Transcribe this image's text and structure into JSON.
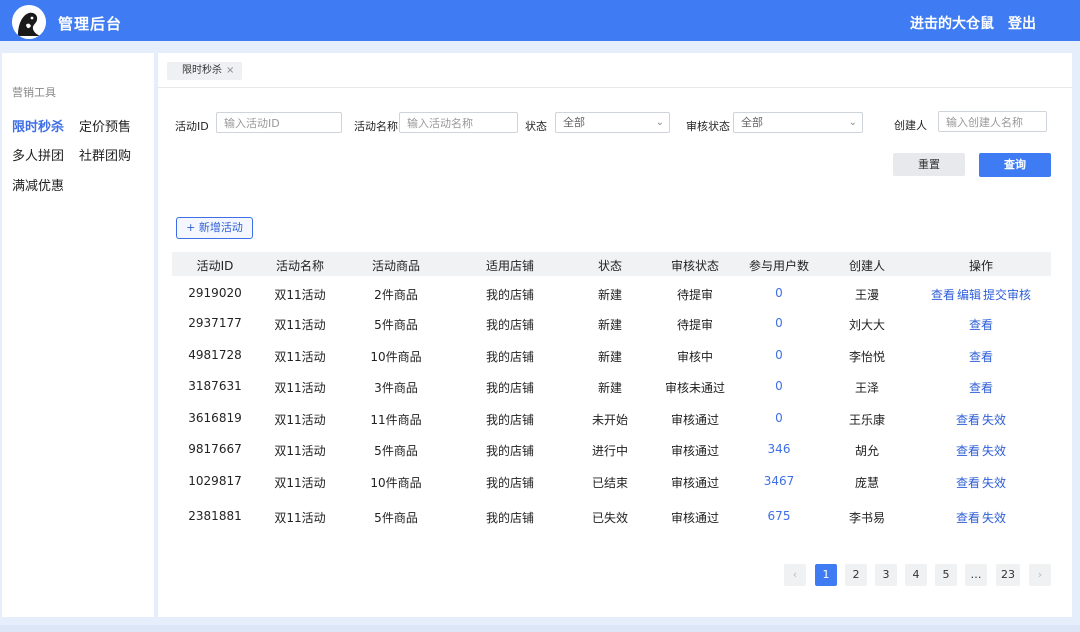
{
  "header": {
    "title": "管理后台",
    "username": "进击的大仓鼠",
    "logout": "登出"
  },
  "sidebar": {
    "section": "营销工具",
    "items": [
      {
        "label": "限时秒杀",
        "active": true
      },
      {
        "label": "定价预售"
      },
      {
        "label": "多人拼团"
      },
      {
        "label": "社群团购"
      },
      {
        "label": "满减优惠"
      }
    ]
  },
  "tabs": [
    {
      "label": "限时秒杀",
      "close": "×"
    }
  ],
  "filters": {
    "activity_id": {
      "label": "活动ID",
      "placeholder": "输入活动ID"
    },
    "activity_name": {
      "label": "活动名称",
      "placeholder": "输入活动名称"
    },
    "status": {
      "label": "状态",
      "value": "全部"
    },
    "review_status": {
      "label": "审核状态",
      "value": "全部"
    },
    "creator": {
      "label": "创建人",
      "placeholder": "输入创建人名称"
    },
    "reset": "重置",
    "query": "查询"
  },
  "add_button": "+ 新增活动",
  "table": {
    "columns": [
      "活动ID",
      "活动名称",
      "活动商品",
      "适用店铺",
      "状态",
      "审核状态",
      "参与用户数",
      "创建人",
      "操作"
    ],
    "rows": [
      {
        "id": "2919020",
        "name": "双11活动",
        "goods": "2件商品",
        "shop": "我的店铺",
        "status": "新建",
        "review": "待提审",
        "users": "0",
        "creator": "王漫",
        "ops": [
          "查看",
          "编辑",
          "提交审核"
        ]
      },
      {
        "id": "2937177",
        "name": "双11活动",
        "goods": "5件商品",
        "shop": "我的店铺",
        "status": "新建",
        "review": "待提审",
        "users": "0",
        "creator": "刘大大",
        "ops": [
          "查看"
        ]
      },
      {
        "id": "4981728",
        "name": "双11活动",
        "goods": "10件商品",
        "shop": "我的店铺",
        "status": "新建",
        "review": "审核中",
        "users": "0",
        "creator": "李怡悦",
        "ops": [
          "查看"
        ]
      },
      {
        "id": "3187631",
        "name": "双11活动",
        "goods": "3件商品",
        "shop": "我的店铺",
        "status": "新建",
        "review": "审核未通过",
        "users": "0",
        "creator": "王泽",
        "ops": [
          "查看"
        ]
      },
      {
        "id": "3616819",
        "name": "双11活动",
        "goods": "11件商品",
        "shop": "我的店铺",
        "status": "未开始",
        "review": "审核通过",
        "users": "0",
        "creator": "王乐康",
        "ops": [
          "查看",
          "失效"
        ]
      },
      {
        "id": "9817667",
        "name": "双11活动",
        "goods": "5件商品",
        "shop": "我的店铺",
        "status": "进行中",
        "review": "审核通过",
        "users": "346",
        "creator": "胡允",
        "ops": [
          "查看",
          "失效"
        ]
      },
      {
        "id": "1029817",
        "name": "双11活动",
        "goods": "10件商品",
        "shop": "我的店铺",
        "status": "已结束",
        "review": "审核通过",
        "users": "3467",
        "creator": "庞慧",
        "ops": [
          "查看",
          "失效"
        ]
      },
      {
        "id": "2381881",
        "name": "双11活动",
        "goods": "5件商品",
        "shop": "我的店铺",
        "status": "已失效",
        "review": "审核通过",
        "users": "675",
        "creator": "李书易",
        "ops": [
          "查看",
          "失效"
        ]
      }
    ]
  },
  "pagination": {
    "prev": "‹",
    "pages": [
      "1",
      "2",
      "3",
      "4",
      "5",
      "…",
      "23"
    ],
    "current": "1",
    "next": "›"
  },
  "colors": {
    "primary": "#3f7cf3",
    "link": "#2f5fd6",
    "background": "#e6eefb"
  }
}
